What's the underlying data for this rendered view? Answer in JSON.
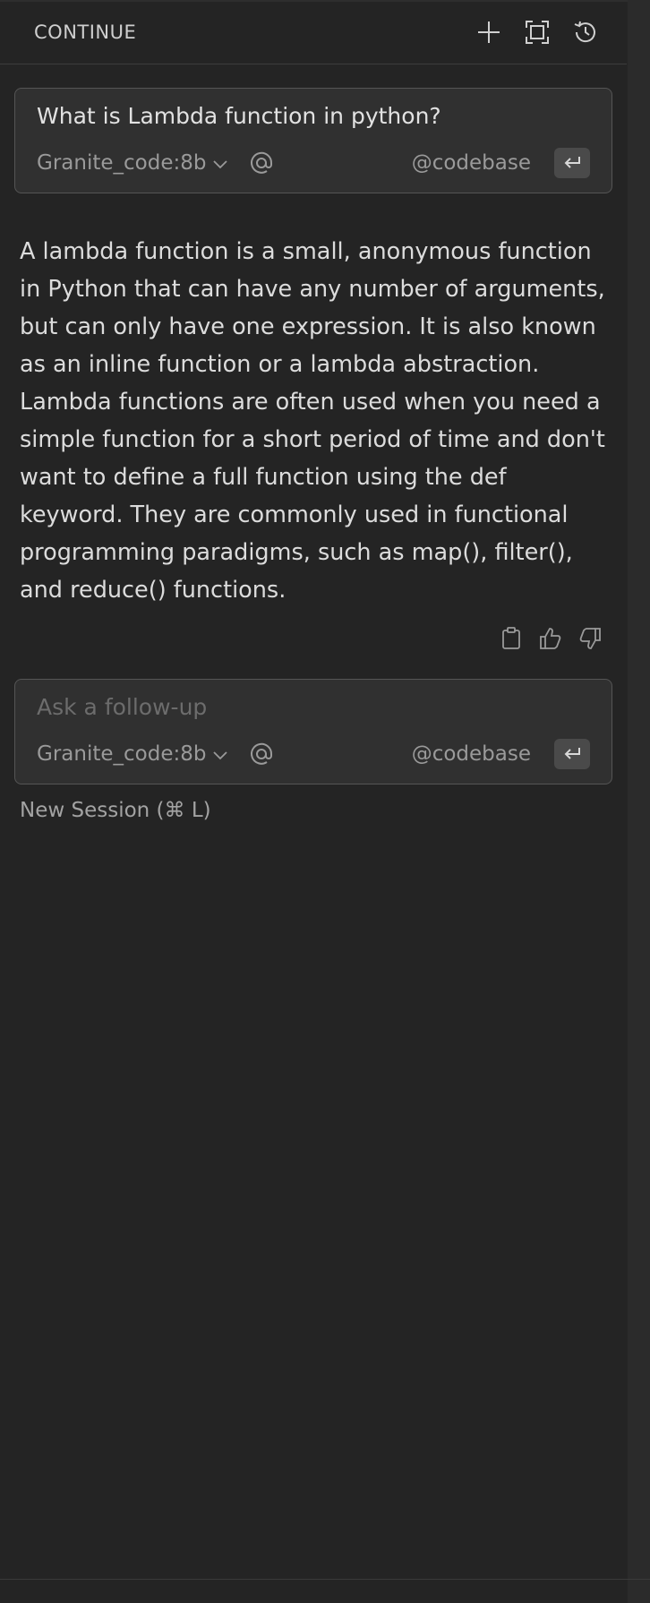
{
  "header": {
    "title": "CONTINUE"
  },
  "question_box": {
    "text": "What is Lambda function in python?",
    "model": "Granite_code:8b",
    "codebase_label": "@codebase"
  },
  "response": {
    "text": "A lambda function is a small, anonymous function in Python that can have any number of arguments, but can only have one expression. It is also known as an inline function or a lambda abstraction. Lambda functions are often used when you need a simple function for a short period of time and don't want to define a full function using the def keyword. They are commonly used in functional programming paradigms, such as map(), filter(), and reduce() functions."
  },
  "followup_box": {
    "placeholder": "Ask a follow-up",
    "model": "Granite_code:8b",
    "codebase_label": "@codebase"
  },
  "footer": {
    "new_session_label": "New Session (⌘ L)"
  },
  "icons": {
    "header": [
      "plus-icon",
      "fullscreen-icon",
      "history-icon"
    ],
    "response_actions": [
      "clipboard-icon",
      "thumbs-up-icon",
      "thumbs-down-icon"
    ]
  },
  "colors": {
    "background": "#242424",
    "input_background": "#303030",
    "input_border": "#555555",
    "muted_text": "#9a9a9a"
  }
}
